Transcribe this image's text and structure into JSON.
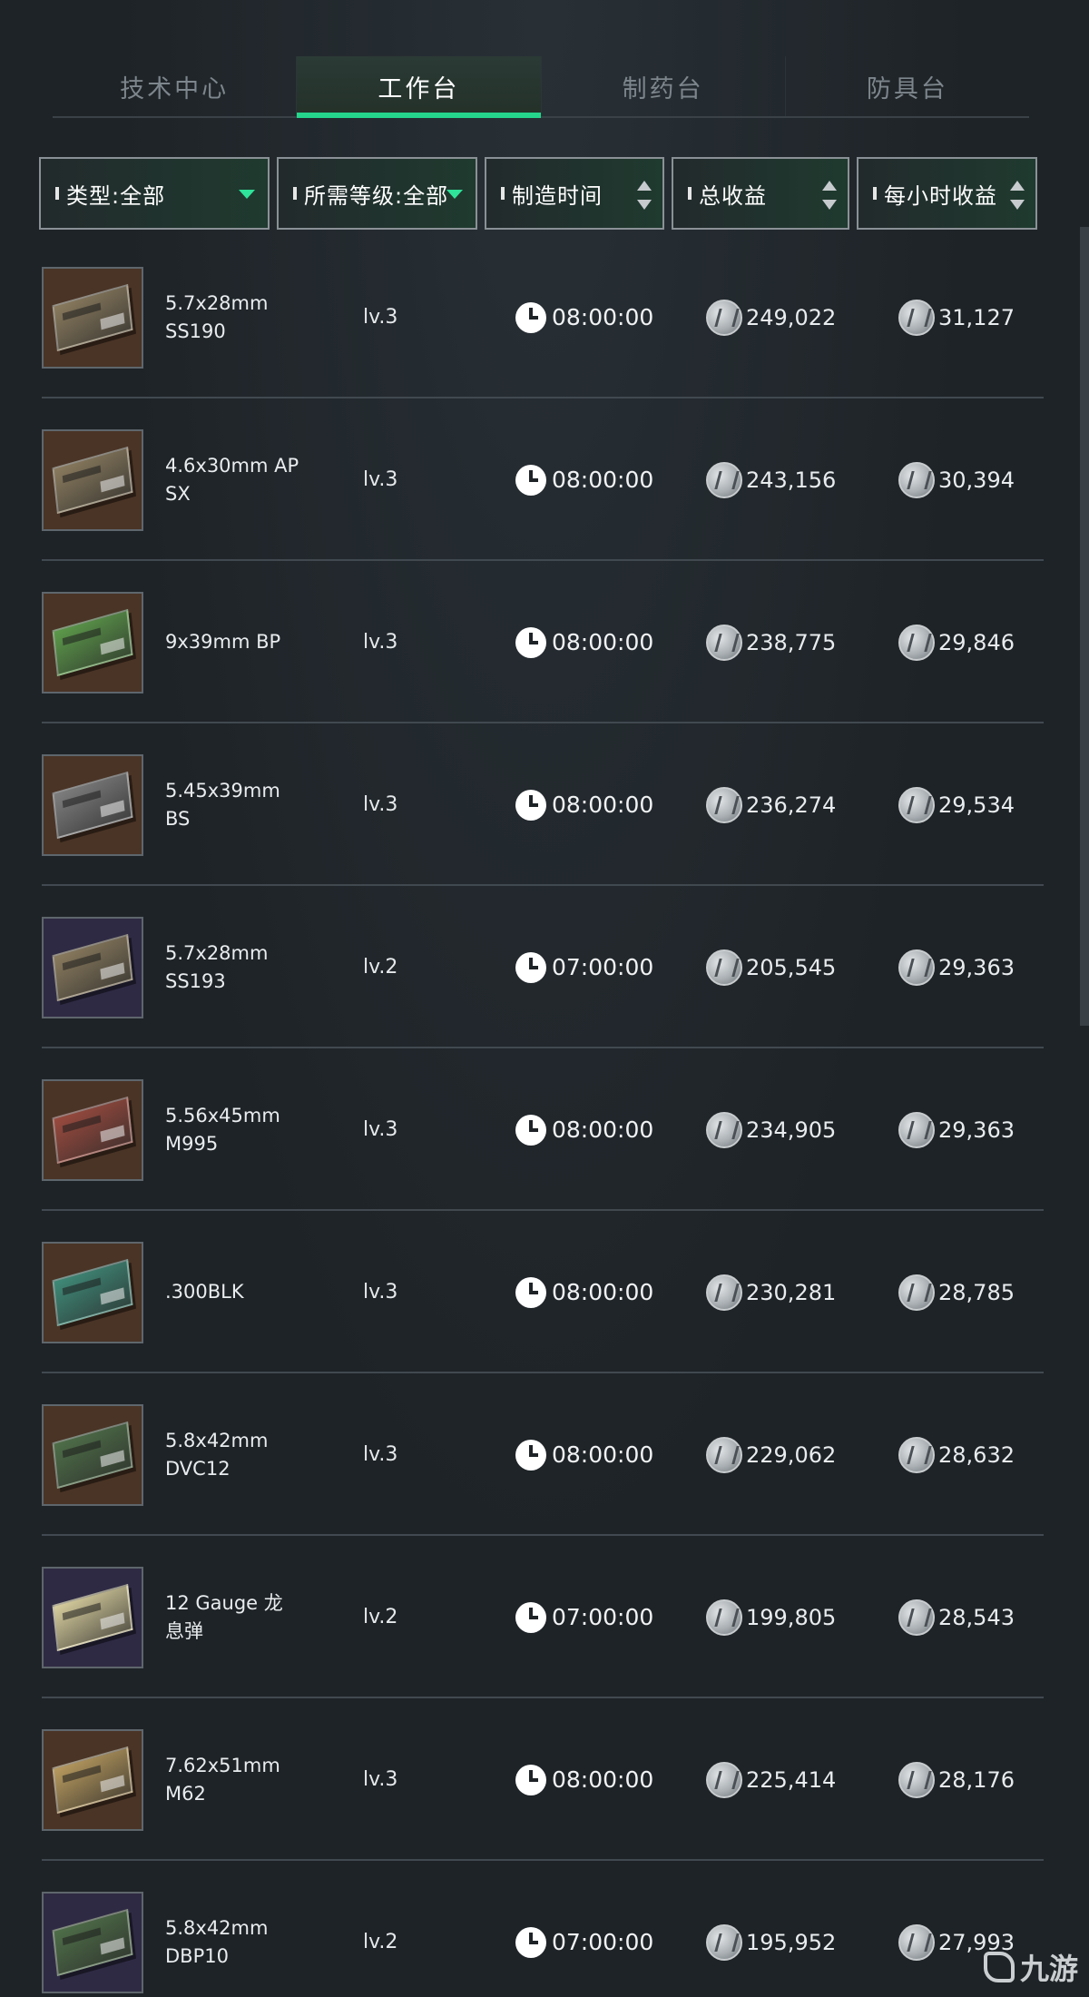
{
  "tabs": [
    {
      "label": "技术中心",
      "active": false
    },
    {
      "label": "工作台",
      "active": true
    },
    {
      "label": "制药台",
      "active": false
    },
    {
      "label": "防具台",
      "active": false
    }
  ],
  "filters": [
    {
      "label": "类型:全部",
      "kind": "dropdown"
    },
    {
      "label": "所需等级:全部",
      "kind": "dropdown"
    },
    {
      "label": "制造时间",
      "kind": "sort"
    },
    {
      "label": "总收益",
      "kind": "sort"
    },
    {
      "label": "每小时收益",
      "kind": "sort"
    }
  ],
  "icons": {
    "clock": "clock-icon",
    "coin": "currency-coin-icon",
    "dropdown": "triangle-down-icon",
    "sort": "sort-arrows-icon"
  },
  "colors": {
    "accent": "#25d58c",
    "background": "#1e2327"
  },
  "items": [
    {
      "name_line1": "5.7x28mm",
      "name_line2": "SS190",
      "level": "lv.3",
      "time": "08:00:00",
      "total": "249,022",
      "hourly": "31,127",
      "box_color": "#8a7b5e",
      "thumb_bg": "#4a3426"
    },
    {
      "name_line1": "4.6x30mm AP",
      "name_line2": "SX",
      "level": "lv.3",
      "time": "08:00:00",
      "total": "243,156",
      "hourly": "30,394",
      "box_color": "#8a7b5e",
      "thumb_bg": "#4a3426"
    },
    {
      "name_line1": "9x39mm BP",
      "name_line2": "",
      "level": "lv.3",
      "time": "08:00:00",
      "total": "238,775",
      "hourly": "29,846",
      "box_color": "#5c9a4a",
      "thumb_bg": "#4a3426"
    },
    {
      "name_line1": "5.45x39mm",
      "name_line2": "BS",
      "level": "lv.3",
      "time": "08:00:00",
      "total": "236,274",
      "hourly": "29,534",
      "box_color": "#7e7e7e",
      "thumb_bg": "#4a3426"
    },
    {
      "name_line1": "5.7x28mm",
      "name_line2": "SS193",
      "level": "lv.2",
      "time": "07:00:00",
      "total": "205,545",
      "hourly": "29,363",
      "box_color": "#8a7b5e",
      "thumb_bg": "#2f2a44"
    },
    {
      "name_line1": "5.56x45mm",
      "name_line2": "M995",
      "level": "lv.3",
      "time": "08:00:00",
      "total": "234,905",
      "hourly": "29,363",
      "box_color": "#9a4a3e",
      "thumb_bg": "#4a3426"
    },
    {
      "name_line1": ".300BLK",
      "name_line2": "",
      "level": "lv.3",
      "time": "08:00:00",
      "total": "230,281",
      "hourly": "28,785",
      "box_color": "#3f8a78",
      "thumb_bg": "#4a3426"
    },
    {
      "name_line1": "5.8x42mm",
      "name_line2": "DVC12",
      "level": "lv.3",
      "time": "08:00:00",
      "total": "229,062",
      "hourly": "28,632",
      "box_color": "#4e6e48",
      "thumb_bg": "#4a3426"
    },
    {
      "name_line1": "12 Gauge 龙",
      "name_line2": "息弹",
      "level": "lv.2",
      "time": "07:00:00",
      "total": "199,805",
      "hourly": "28,543",
      "box_color": "#d8ce9e",
      "thumb_bg": "#2f2a44"
    },
    {
      "name_line1": "7.62x51mm",
      "name_line2": "M62",
      "level": "lv.3",
      "time": "08:00:00",
      "total": "225,414",
      "hourly": "28,176",
      "box_color": "#b89a5e",
      "thumb_bg": "#4a3426"
    },
    {
      "name_line1": "5.8x42mm",
      "name_line2": "DBP10",
      "level": "lv.2",
      "time": "07:00:00",
      "total": "195,952",
      "hourly": "27,993",
      "box_color": "#4e6e48",
      "thumb_bg": "#2f2a44"
    }
  ],
  "watermark": {
    "text": "九游"
  }
}
